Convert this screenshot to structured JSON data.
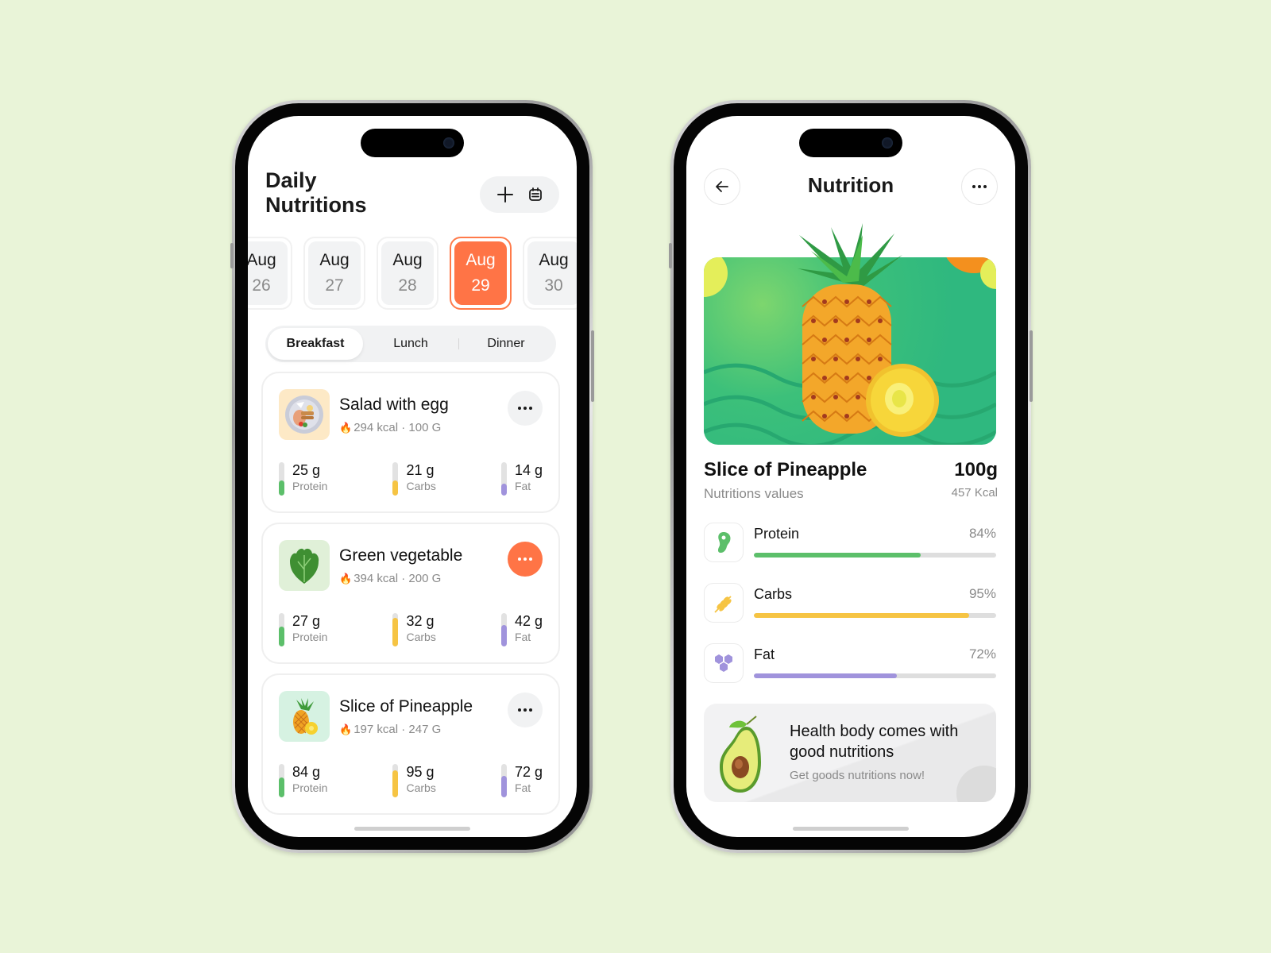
{
  "colors": {
    "background": "#e9f4d8",
    "accent": "#ff7446",
    "protein": "#5cbf6a",
    "carbs": "#f6c443",
    "fat": "#a093dc"
  },
  "left_screen": {
    "title_line1": "Daily",
    "title_line2": "Nutritions",
    "actions": {
      "add_icon": "plus-icon",
      "calendar_icon": "calendar-icon"
    },
    "dates": [
      {
        "month": "Aug",
        "day": "26",
        "active": false
      },
      {
        "month": "Aug",
        "day": "27",
        "active": false
      },
      {
        "month": "Aug",
        "day": "28",
        "active": false
      },
      {
        "month": "Aug",
        "day": "29",
        "active": true
      },
      {
        "month": "Aug",
        "day": "30",
        "active": false
      }
    ],
    "meal_tabs": [
      {
        "label": "Breakfast",
        "active": true
      },
      {
        "label": "Lunch",
        "active": false
      },
      {
        "label": "Dinner",
        "active": false
      }
    ],
    "foods": [
      {
        "name": "Salad with egg",
        "kcal": "294 kcal",
        "weight": "100 G",
        "menu_active": false,
        "macros": [
          {
            "value": "25 g",
            "label": "Protein",
            "level": 0.45
          },
          {
            "value": "21 g",
            "label": "Carbs",
            "level": 0.45
          },
          {
            "value": "14 g",
            "label": "Fat",
            "level": 0.35
          }
        ]
      },
      {
        "name": "Green vegetable",
        "kcal": "394 kcal",
        "weight": "200 G",
        "menu_active": true,
        "macros": [
          {
            "value": "27 g",
            "label": "Protein",
            "level": 0.6
          },
          {
            "value": "32 g",
            "label": "Carbs",
            "level": 0.85
          },
          {
            "value": "42 g",
            "label": "Fat",
            "level": 0.65
          }
        ]
      },
      {
        "name": "Slice of Pineapple",
        "kcal": "197 kcal",
        "weight": "247 G",
        "menu_active": false,
        "macros": [
          {
            "value": "84 g",
            "label": "Protein",
            "level": 0.6
          },
          {
            "value": "95 g",
            "label": "Carbs",
            "level": 0.8
          },
          {
            "value": "72 g",
            "label": "Fat",
            "level": 0.65
          }
        ]
      }
    ]
  },
  "right_screen": {
    "title": "Nutrition",
    "back_icon": "arrow-left-icon",
    "more_icon": "more-horizontal-icon",
    "food_name": "Slice of Pineapple",
    "subtitle": "Nutritions values",
    "weight": "100g",
    "kcal": "457 Kcal",
    "nutrients": [
      {
        "label": "Protein",
        "percent": "84%",
        "icon": "protein-bean-icon",
        "fill": 0.69
      },
      {
        "label": "Carbs",
        "percent": "95%",
        "icon": "wheat-icon",
        "fill": 0.89
      },
      {
        "label": "Fat",
        "percent": "72%",
        "icon": "fat-hexagons-icon",
        "fill": 0.59
      }
    ],
    "promo": {
      "title": "Health body comes with good nutritions",
      "subtitle": "Get goods nutritions now!"
    }
  }
}
